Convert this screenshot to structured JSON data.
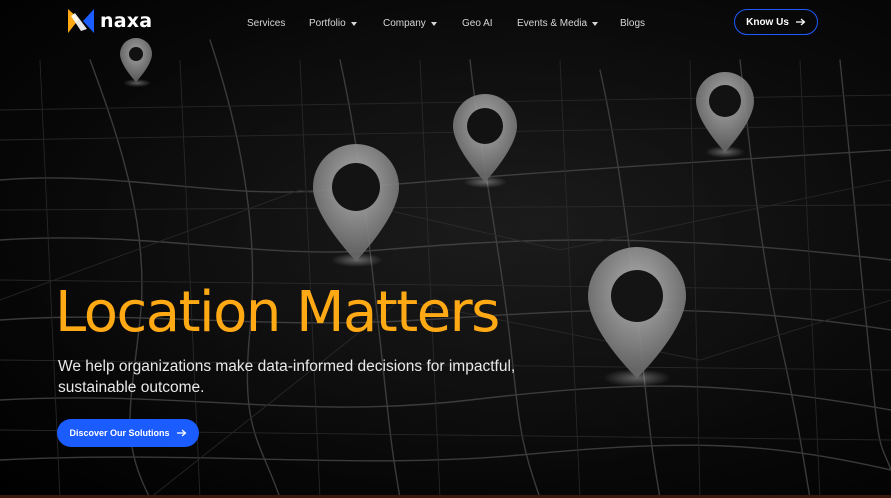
{
  "brand": {
    "name": "naxa",
    "accent": "#ffa914",
    "primary_blue": "#1b5cff"
  },
  "nav": {
    "items": [
      {
        "label": "Services",
        "dropdown": false
      },
      {
        "label": "Portfolio",
        "dropdown": true
      },
      {
        "label": "Company",
        "dropdown": true
      },
      {
        "label": "Geo AI",
        "dropdown": false
      },
      {
        "label": "Events & Media",
        "dropdown": true
      },
      {
        "label": "Blogs",
        "dropdown": false
      }
    ],
    "cta_label": "Know Us",
    "cta_icon": "arrow-right-icon"
  },
  "hero": {
    "headline": "Location Matters",
    "subtitle": "We help organizations make data-informed decisions for impactful, sustainable outcome.",
    "cta_label": "Discover Our Solutions",
    "cta_icon": "arrow-right-icon",
    "background": "dark map with location pins"
  }
}
